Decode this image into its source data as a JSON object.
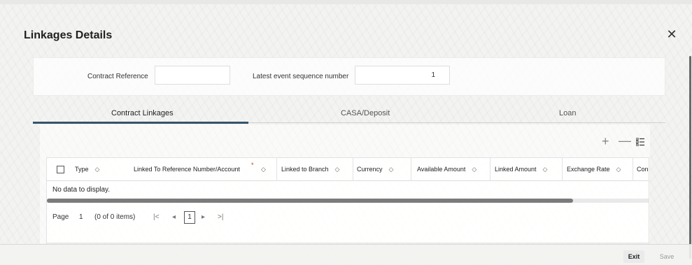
{
  "dialog": {
    "title": "Linkages Details",
    "close_icon": "close-icon"
  },
  "header": {
    "contract_reference_label": "Contract Reference",
    "contract_reference_value": "",
    "latest_event_label": "Latest event sequence number",
    "latest_event_value": "1"
  },
  "tabs": [
    {
      "label": "Contract Linkages",
      "active": true
    },
    {
      "label": "CASA/Deposit",
      "active": false
    },
    {
      "label": "Loan",
      "active": false
    }
  ],
  "toolbar": {
    "add_icon": "plus-icon",
    "remove_icon": "minus-icon",
    "columns_icon": "list-columns-icon"
  },
  "table": {
    "columns": [
      "Type",
      "Linked To Reference Number/Account",
      "Linked to Branch",
      "Currency",
      "Available Amount",
      "Linked Amount",
      "Exchange Rate",
      "Con"
    ],
    "required_marker": "*",
    "empty_message": "No data to display."
  },
  "pagination": {
    "page_label": "Page",
    "page_value": "1",
    "items_text": "(0 of 0 items)",
    "current_page": "1",
    "first_icon": "|<",
    "prev_icon": "◂",
    "next_icon": "▸",
    "last_icon": ">|"
  },
  "footer": {
    "exit_label": "Exit",
    "save_label": "Save"
  },
  "colors": {
    "tab_underline": "#35546b",
    "required": "#c0392b"
  }
}
